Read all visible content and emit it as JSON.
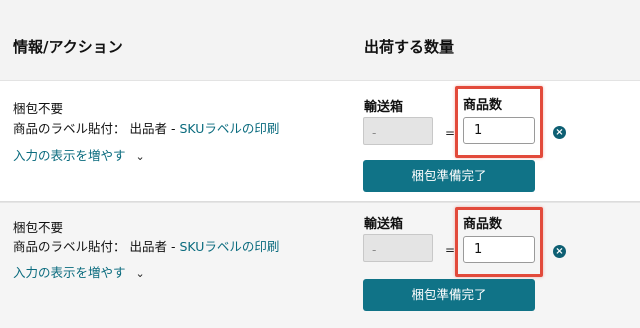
{
  "header": {
    "info_action": "情報/アクション",
    "quantity_to_ship": "出荷する数量"
  },
  "rows": [
    {
      "packing_note": "梱包不要",
      "label_prefix": "商品のラベル貼付： 出品者 - ",
      "sku_link": "SKUラベルの印刷",
      "show_more": "入力の表示を増やす",
      "box_label": "輸送箱",
      "box_value": "-",
      "equals": "=",
      "units_label": "商品数",
      "units_value": "1",
      "pack_button": "梱包準備完了"
    },
    {
      "packing_note": "梱包不要",
      "label_prefix": "商品のラベル貼付： 出品者 - ",
      "sku_link": "SKUラベルの印刷",
      "show_more": "入力の表示を増やす",
      "box_label": "輸送箱",
      "box_value": "-",
      "equals": "=",
      "units_label": "商品数",
      "units_value": "1",
      "pack_button": "梱包準備完了"
    }
  ],
  "icons": {
    "remove": "close-circle-icon",
    "expand": "chevron-down-icon"
  },
  "colors": {
    "accent": "#107387",
    "link": "#0a6b7e",
    "highlight": "#e24a3b"
  }
}
